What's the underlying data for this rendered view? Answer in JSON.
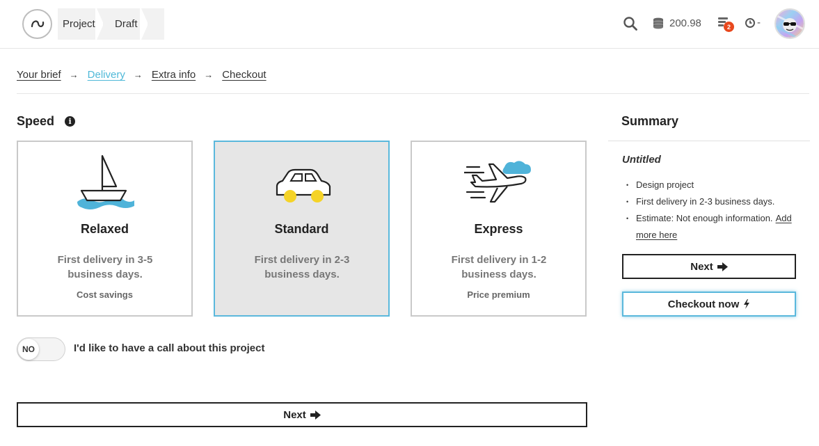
{
  "header": {
    "breadcrumbs": [
      "Project",
      "Draft"
    ],
    "coins": "200.98",
    "tasks_badge": "2",
    "clock_value": "-"
  },
  "steps": [
    {
      "label": "Your brief",
      "active": false
    },
    {
      "label": "Delivery",
      "active": true
    },
    {
      "label": "Extra info",
      "active": false
    },
    {
      "label": "Checkout",
      "active": false
    }
  ],
  "speed": {
    "title": "Speed",
    "options": [
      {
        "name": "Relaxed",
        "description": "First delivery in 3-5 business days.",
        "note": "Cost savings",
        "icon": "sailboat-icon",
        "selected": false
      },
      {
        "name": "Standard",
        "description": "First delivery in 2-3 business days.",
        "note": "",
        "icon": "car-icon",
        "selected": true
      },
      {
        "name": "Express",
        "description": "First delivery in 1-2 business days.",
        "note": "Price premium",
        "icon": "airplane-icon",
        "selected": false
      }
    ]
  },
  "call_toggle": {
    "state": "NO",
    "label": "I'd like to have a call about this project"
  },
  "next_label": "Next",
  "summary": {
    "title": "Summary",
    "project_name": "Untitled",
    "items": [
      "Design project",
      "First delivery in 2-3 business days."
    ],
    "estimate": "Estimate: Not enough information.",
    "add_more": "Add more here",
    "next_label": "Next",
    "checkout_label": "Checkout now"
  },
  "colors": {
    "accent": "#4fb9d8",
    "badge": "#e8481e",
    "wheel_yellow": "#f5d327",
    "water_blue": "#4fb3d9"
  }
}
